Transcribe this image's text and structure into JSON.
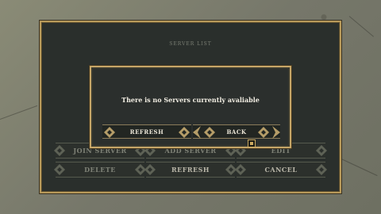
{
  "panel": {
    "title": "SERVER LIST"
  },
  "background_buttons": {
    "join_server": "JOIN SERVER",
    "add_server": "ADD SERVER",
    "edit": "EDIT",
    "delete": "DELETE",
    "refresh": "REFRESH",
    "cancel": "CANCEL"
  },
  "dialog": {
    "message": "There is no Servers currently avaliable",
    "refresh_label": "REFRESH",
    "back_label": "BACK"
  },
  "colors": {
    "gold_accent": "#c6a668",
    "panel_bg": "#2a2f2c",
    "text": "#f1ede2"
  },
  "icons": {
    "button_cap": "diamond-icon",
    "back_arrows": "chevron-icon",
    "cursor": "cursor-icon"
  }
}
